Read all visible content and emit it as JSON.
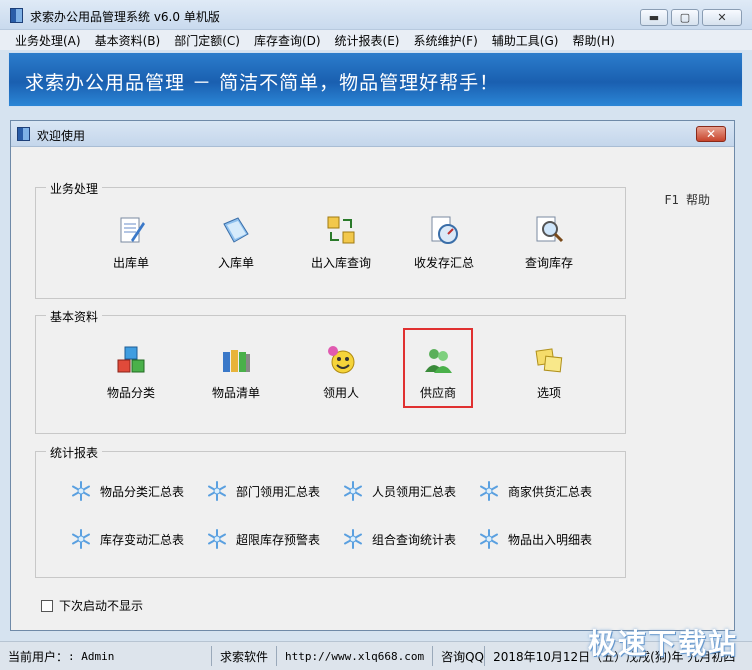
{
  "window": {
    "title": "求索办公用品管理系统 v6.0 单机版"
  },
  "menu": [
    "业务处理(A)",
    "基本资料(B)",
    "部门定额(C)",
    "库存查询(D)",
    "统计报表(E)",
    "系统维护(F)",
    "辅助工具(G)",
    "帮助(H)"
  ],
  "banner": {
    "text": "求索办公用品管理 － 简洁不简单，物品管理好帮手！"
  },
  "dialog": {
    "title": "欢迎使用",
    "help": "F1 帮助"
  },
  "groups": {
    "business": {
      "label": "业务处理",
      "items": [
        {
          "label": "出库单",
          "icon": "outbound-doc-icon"
        },
        {
          "label": "入库单",
          "icon": "inbound-doc-icon"
        },
        {
          "label": "出入库查询",
          "icon": "inout-query-icon"
        },
        {
          "label": "收发存汇总",
          "icon": "summary-gauge-icon"
        },
        {
          "label": "查询库存",
          "icon": "search-stock-icon"
        }
      ]
    },
    "basic": {
      "label": "基本资料",
      "items": [
        {
          "label": "物品分类",
          "icon": "cubes-icon"
        },
        {
          "label": "物品清单",
          "icon": "binders-icon"
        },
        {
          "label": "领用人",
          "icon": "smiley-icon"
        },
        {
          "label": "供应商",
          "icon": "users-icon"
        },
        {
          "label": "选项",
          "icon": "notes-icon"
        }
      ]
    },
    "reports": {
      "label": "统计报表",
      "items": [
        "物品分类汇总表",
        "部门领用汇总表",
        "人员领用汇总表",
        "商家供货汇总表",
        "库存变动汇总表",
        "超限库存预警表",
        "组合查询统计表",
        "物品出入明细表"
      ]
    }
  },
  "checkbox": {
    "label": "下次启动不显示"
  },
  "status": {
    "user_label": "当前用户：",
    "user_value": ": Admin",
    "company": "求索软件",
    "url": "http://www.xlq668.com",
    "qq": "咨询QQ",
    "date": "2018年10月12日（五）戊戌(狗)年 九月初四"
  },
  "watermark": "极速下载站",
  "colors": {
    "banner": "#1a5fb0",
    "highlight": "#e03030"
  }
}
